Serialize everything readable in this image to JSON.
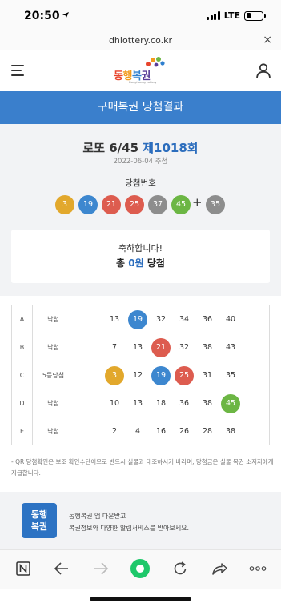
{
  "status_bar": {
    "time": "20:50",
    "network": "LTE",
    "battery_level": 0.3
  },
  "browser": {
    "url": "dhlottery.co.kr",
    "close_label": "×"
  },
  "header": {
    "logo_chars": [
      "동",
      "행",
      "복",
      "권"
    ],
    "logo_sub": "Donghaeng Lottery"
  },
  "page_title": "구매복권 당첨결과",
  "game": {
    "name": "로또 6/45",
    "round": "제1018회",
    "draw_date": "2022-06-04 추첨"
  },
  "winning": {
    "label": "당첨번호",
    "numbers": [
      3,
      19,
      21,
      25,
      37,
      45
    ],
    "bonus": 35,
    "plus": "+"
  },
  "result": {
    "greeting": "축하합니다!",
    "prefix": "총",
    "amount": "0원",
    "suffix": "당첨"
  },
  "tickets": [
    {
      "game": "A",
      "status": "낙첨",
      "numbers": [
        13,
        19,
        32,
        34,
        36,
        40
      ]
    },
    {
      "game": "B",
      "status": "낙첨",
      "numbers": [
        7,
        13,
        21,
        32,
        38,
        43
      ]
    },
    {
      "game": "C",
      "status": "5등당첨",
      "numbers": [
        3,
        12,
        19,
        25,
        31,
        35
      ]
    },
    {
      "game": "D",
      "status": "낙첨",
      "numbers": [
        10,
        13,
        18,
        36,
        38,
        45
      ]
    },
    {
      "game": "E",
      "status": "낙첨",
      "numbers": [
        2,
        4,
        16,
        26,
        28,
        38
      ]
    }
  ],
  "note": "- QR 당첨확인은 보조 확인수단이므로 반드시 실물과 대조하시기 바라며, 당첨금은 실물 복권 소지자에게 지급합니다.",
  "app_banner": {
    "icon_line1": "동행",
    "icon_line2": "복권",
    "line1": "동행복권 앱 다운받고",
    "line2": "복권정보와 다양한 알림서비스를 받아보세요."
  },
  "colors": {
    "title_bar": "#3a7fcc",
    "ball_yellow": "#e2a82c",
    "ball_blue": "#3d87cf",
    "ball_red": "#dd5c4f",
    "ball_gray": "#8d8d8d",
    "ball_green": "#6cb644"
  },
  "toolbar_icons": [
    "naver-n-icon",
    "back-arrow-icon",
    "forward-arrow-icon",
    "home-green-icon",
    "refresh-icon",
    "share-icon",
    "more-icon"
  ]
}
